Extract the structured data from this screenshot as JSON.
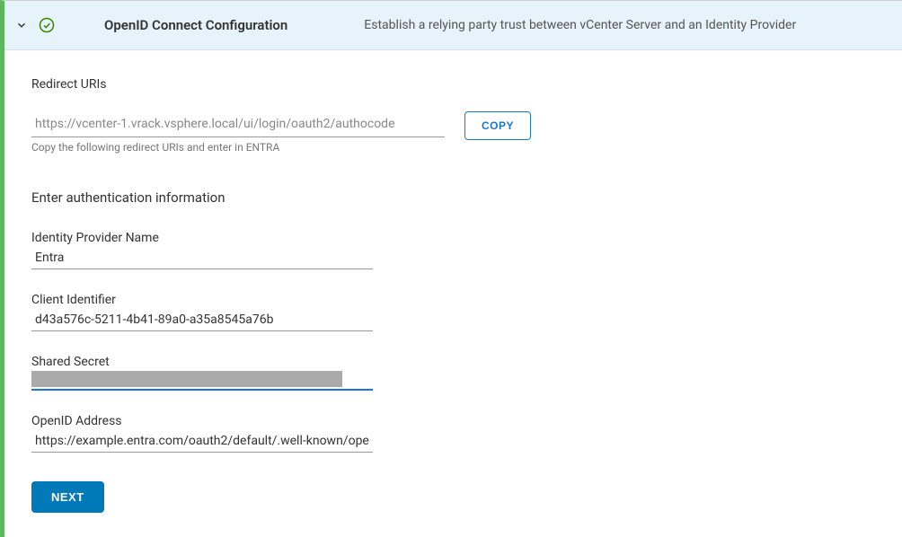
{
  "header": {
    "title": "OpenID Connect Configuration",
    "subtitle": "Establish a relying party trust between vCenter Server and an Identity Provider"
  },
  "redirect": {
    "label": "Redirect URIs",
    "uri": "https://vcenter-1.vrack.vsphere.local/ui/login/oauth2/authocode",
    "helper": "Copy the following redirect URIs and enter in ENTRA",
    "copy_label": "COPY"
  },
  "auth": {
    "heading": "Enter authentication information",
    "provider_name": {
      "label": "Identity Provider Name",
      "value": "Entra"
    },
    "client_identifier": {
      "label": "Client Identifier",
      "value": "d43a576c-5211-4b41-89a0-a35a8545a76b"
    },
    "shared_secret": {
      "label": "Shared Secret",
      "value": ""
    },
    "openid_address": {
      "label": "OpenID Address",
      "value": "https://example.entra.com/oauth2/default/.well-known/ope"
    }
  },
  "actions": {
    "next_label": "NEXT"
  }
}
